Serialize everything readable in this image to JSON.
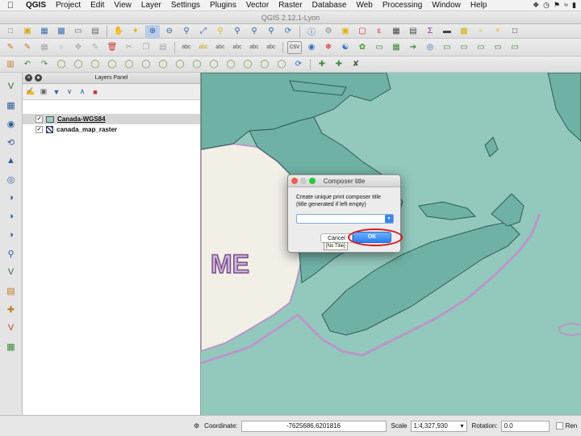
{
  "menubar": {
    "app": "QGIS",
    "items": [
      "Project",
      "Edit",
      "View",
      "Layer",
      "Settings",
      "Plugins",
      "Vector",
      "Raster",
      "Database",
      "Web",
      "Processing",
      "Window",
      "Help"
    ]
  },
  "window": {
    "title": "QGIS 2.12.1-Lyon"
  },
  "layers_panel": {
    "title": "Layers Panel",
    "layers": [
      {
        "name": "Canada-WGS84",
        "checked": true,
        "selected": true,
        "swatch_color": "#9bd0c9"
      },
      {
        "name": "canada_map_raster",
        "checked": true,
        "selected": false
      }
    ]
  },
  "map": {
    "label": "ME",
    "colors": {
      "water": "#93c8bd",
      "land": "#6fb1a4",
      "us_land": "#f2efe7",
      "border": "#b997c8"
    }
  },
  "dialog": {
    "title": "Composer title",
    "message_line1": "Create unique print composer title",
    "message_line2": "(title generated if left empty)",
    "input_value": "",
    "cancel_label": "Cancel",
    "ok_label": "OK",
    "tooltip": "[No Title]"
  },
  "statusbar": {
    "coordinate_label": "Coordinate:",
    "coordinate_value": "-7625686,6201816",
    "scale_label": "Scale",
    "scale_value": "1:4,327,930",
    "rotation_label": "Rotation:",
    "rotation_value": "0.0",
    "render_label": "Ren"
  },
  "icons": {
    "toolbar1": [
      "new-project-icon",
      "open-project-icon",
      "save-project-icon",
      "save-as-icon",
      "new-composer-icon",
      "composer-manager-icon",
      "pan-icon",
      "pan-to-selection-icon",
      "zoom-in-icon",
      "zoom-out-icon",
      "zoom-actual-icon",
      "zoom-full-icon",
      "zoom-selection-icon",
      "zoom-layer-icon",
      "zoom-last-icon",
      "zoom-next-icon",
      "refresh-icon",
      "identify-icon",
      "action-icon",
      "select-icon",
      "deselect-icon",
      "expression-select-icon",
      "attribute-table-icon",
      "field-calculator-icon",
      "statistics-icon",
      "measure-icon",
      "annotation-icon",
      "text-annotation-icon",
      "map-tips-icon",
      "bookmark-icon"
    ]
  }
}
